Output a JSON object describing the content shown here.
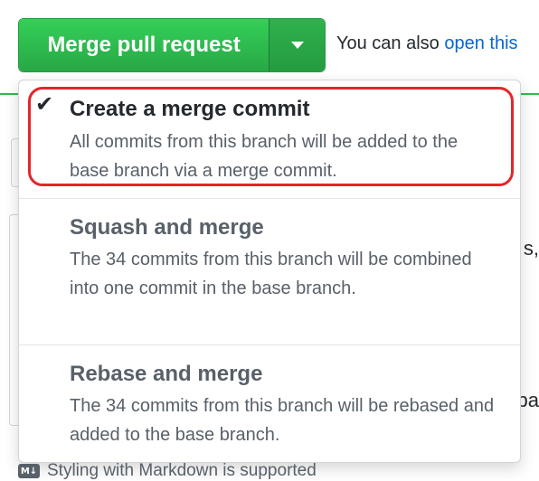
{
  "merge_button": {
    "label": "Merge pull request",
    "toggle_icon": "caret-down-icon"
  },
  "alternatives": {
    "prefix": "You can also ",
    "link_text": "open this"
  },
  "background": {
    "right_fragment_1": "s,",
    "right_fragment_2": "pa"
  },
  "merge_menu": {
    "selected_index": 0,
    "items": [
      {
        "title": "Create a merge commit",
        "description": "All commits from this branch will be added to the base branch via a merge commit.",
        "checked": true,
        "highlighted": true
      },
      {
        "title": "Squash and merge",
        "description": "The 34 commits from this branch will be combined into one commit in the base branch.",
        "checked": false
      },
      {
        "title": "Rebase and merge",
        "description": "The 34 commits from this branch will be rebased and added to the base branch.",
        "checked": false
      }
    ]
  },
  "footer": {
    "markdown_text": "Styling with Markdown is supported",
    "markdown_icon_label": "M↓"
  },
  "colors": {
    "merge_green": "#2ea44f",
    "link_blue": "#0366d6",
    "highlight_red": "#e3262b",
    "muted_text": "#586069"
  }
}
